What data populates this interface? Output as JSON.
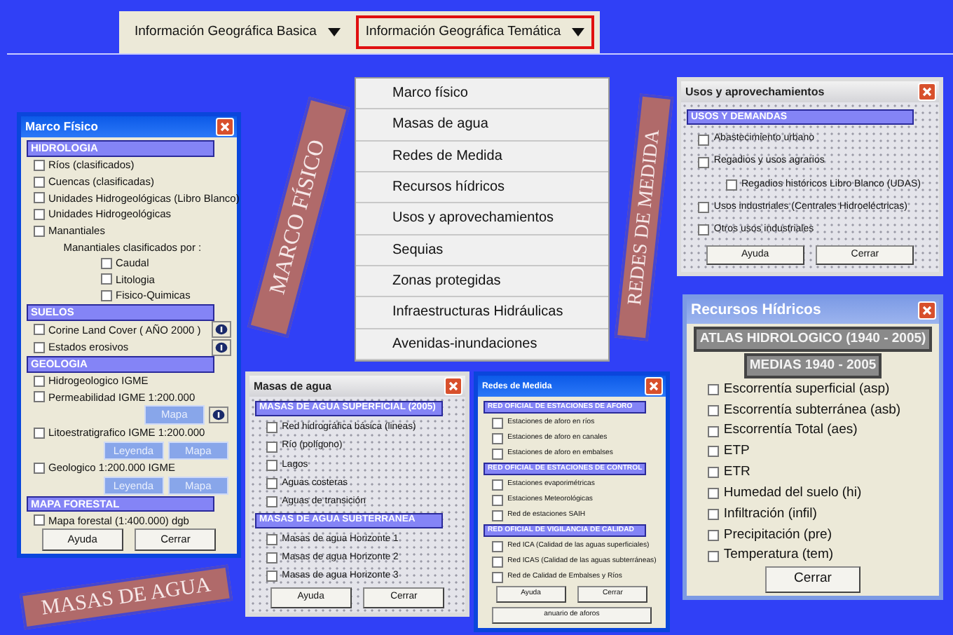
{
  "menubar": [
    {
      "label": "Información Geográfica Basica",
      "selected": false
    },
    {
      "label": "Información Geográfica Temática",
      "selected": true
    }
  ],
  "dropdown": {
    "items": [
      "Marco físico",
      "Masas de agua",
      "Redes de Medida",
      "Recursos hídricos",
      "Usos y aprovechamientos",
      "Sequias",
      "Zonas protegidas",
      "Infraestructuras Hidráulicas",
      "Avenidas-inundaciones"
    ]
  },
  "windows": [
    {
      "title": "Marco Físico",
      "kind": "xp-active",
      "grid": false,
      "rows": [
        {
          "kind": "section",
          "label": "HIDROLOGIA"
        },
        {
          "kind": "check",
          "label": "Ríos (clasificados)",
          "checked": false
        },
        {
          "kind": "check",
          "label": "Cuencas (clasificadas)",
          "checked": false
        },
        {
          "kind": "check",
          "label": "Unidades Hidrogeológicas (Libro Blanco)",
          "checked": false
        },
        {
          "kind": "check",
          "label": "Unidades Hidrogeológicas",
          "checked": false
        },
        {
          "kind": "check",
          "label": "Manantiales",
          "checked": false
        },
        {
          "kind": "note",
          "label": "Manantiales clasificados por :"
        },
        {
          "kind": "subcheck",
          "label": "Caudal",
          "checked": false
        },
        {
          "kind": "subcheck",
          "label": "Litologia",
          "checked": false
        },
        {
          "kind": "subcheck",
          "label": "Fisico-Quimicas",
          "checked": false
        },
        {
          "kind": "section",
          "label": "SUELOS"
        },
        {
          "kind": "check",
          "label": "Corine Land Cover ( AÑO 2000 )",
          "checked": false,
          "info": true
        },
        {
          "kind": "check",
          "label": "Estados erosivos",
          "checked": false,
          "info": true
        },
        {
          "kind": "section",
          "label": "GEOLOGIA"
        },
        {
          "kind": "check",
          "label": "Hidrogeologico IGME",
          "checked": false
        },
        {
          "kind": "check",
          "label": "Permeabilidad IGME 1:200.000",
          "checked": false,
          "info": true,
          "buttons": [
            "Mapa"
          ]
        },
        {
          "kind": "check",
          "label": "Litoestratigrafico IGME 1:200.000",
          "checked": false,
          "buttons": [
            "Leyenda",
            "Mapa"
          ]
        },
        {
          "kind": "check",
          "label": "Geologico 1:200.000 IGME",
          "checked": false,
          "buttons": [
            "Leyenda",
            "Mapa"
          ]
        },
        {
          "kind": "section",
          "label": "MAPA FORESTAL"
        },
        {
          "kind": "check",
          "label": "Mapa forestal (1:400.000) dgb",
          "checked": false
        },
        {
          "kind": "buttons",
          "buttons": [
            "Ayuda",
            "Cerrar"
          ]
        }
      ]
    },
    {
      "title": "Usos y aprovechamientos",
      "kind": "classic",
      "grid": true,
      "rows": [
        {
          "kind": "section",
          "label": "USOS Y DEMANDAS"
        },
        {
          "kind": "check",
          "label": "Abastecimiento urbano",
          "checked": false
        },
        {
          "kind": "check",
          "label": "Regadios y usos agrarios",
          "checked": false
        },
        {
          "kind": "subcheck",
          "label": "Regadios históricos Libro Blanco (UDAS)",
          "checked": false
        },
        {
          "kind": "check",
          "label": "Usos industriales (Centrales Hidroeléctricas)",
          "checked": false
        },
        {
          "kind": "check",
          "label": "Otros usos industriales",
          "checked": false
        },
        {
          "kind": "buttons",
          "buttons": [
            "Ayuda",
            "Cerrar"
          ]
        }
      ]
    },
    {
      "title": "Recursos Hídricos",
      "kind": "xp-inactive",
      "grid": false,
      "rows": [
        {
          "kind": "caption",
          "label": "ATLAS HIDROLOGICO (1940 - 2005)"
        },
        {
          "kind": "caption",
          "label": "MEDIAS 1940 - 2005"
        },
        {
          "kind": "check",
          "label": "Escorrentía superficial (asp)",
          "checked": false
        },
        {
          "kind": "check",
          "label": "Escorrentía subterránea (asb)",
          "checked": false
        },
        {
          "kind": "check",
          "label": "Escorrentía Total (aes)",
          "checked": false
        },
        {
          "kind": "check",
          "label": "ETP",
          "checked": false
        },
        {
          "kind": "check",
          "label": "ETR",
          "checked": false
        },
        {
          "kind": "check",
          "label": "Humedad del suelo (hi)",
          "checked": false
        },
        {
          "kind": "check",
          "label": "Infiltración (infil)",
          "checked": false
        },
        {
          "kind": "check",
          "label": "Precipitación (pre)",
          "checked": false
        },
        {
          "kind": "check",
          "label": "Temperatura (tem)",
          "checked": false
        },
        {
          "kind": "buttons",
          "buttons": [
            "Cerrar"
          ]
        }
      ]
    },
    {
      "title": "Masas de agua",
      "kind": "classic",
      "grid": true,
      "rows": [
        {
          "kind": "section",
          "label": "MASAS DE AGUA SUPERFICIAL (2005)"
        },
        {
          "kind": "check",
          "label": "Red hidrográfica básica (lineas)",
          "checked": false
        },
        {
          "kind": "check",
          "label": "Río (polígono)",
          "checked": false
        },
        {
          "kind": "check",
          "label": "Lagos",
          "checked": false
        },
        {
          "kind": "check",
          "label": "Aguas costeras",
          "checked": false
        },
        {
          "kind": "check",
          "label": "Aguas de transición",
          "checked": false
        },
        {
          "kind": "section",
          "label": "MASAS DE AGUA SUBTERRANEA"
        },
        {
          "kind": "check",
          "label": "Masas de agua Horizonte 1",
          "checked": false
        },
        {
          "kind": "check",
          "label": "Masas de agua Horizonte 2",
          "checked": false
        },
        {
          "kind": "check",
          "label": "Masas de agua Horizonte 3",
          "checked": false
        },
        {
          "kind": "buttons",
          "buttons": [
            "Ayuda",
            "Cerrar"
          ]
        }
      ]
    },
    {
      "title": "Redes de Medida",
      "kind": "xp-active",
      "grid": false,
      "rows": [
        {
          "kind": "section",
          "label": "RED OFICIAL DE ESTACIONES DE AFORO"
        },
        {
          "kind": "check",
          "label": "Estaciones de aforo en ríos",
          "checked": false
        },
        {
          "kind": "check",
          "label": "Estaciones de aforo en canales",
          "checked": false
        },
        {
          "kind": "check",
          "label": "Estaciones de aforo en embalses",
          "checked": false
        },
        {
          "kind": "section",
          "label": "RED OFICIAL DE ESTACIONES DE CONTROL"
        },
        {
          "kind": "check",
          "label": "Estaciones evaporimétricas",
          "checked": false
        },
        {
          "kind": "check",
          "label": "Estaciones Meteorológicas",
          "checked": false
        },
        {
          "kind": "check",
          "label": "Red de estaciones SAIH",
          "checked": false
        },
        {
          "kind": "section",
          "label": "RED OFICIAL DE VIGILANCIA DE CALIDAD"
        },
        {
          "kind": "check",
          "label": "Red ICA (Calidad de las aguas superficiales)",
          "checked": false
        },
        {
          "kind": "check",
          "label": "Red ICAS (Calidad de las aguas subterráneas)",
          "checked": false
        },
        {
          "kind": "check",
          "label": "Red de Calidad de Embalses y Ríos",
          "checked": false
        },
        {
          "kind": "buttons",
          "buttons": [
            "Ayuda",
            "Cerrar"
          ]
        },
        {
          "kind": "buttons",
          "buttons": [
            "anuario de aforos"
          ]
        }
      ]
    }
  ],
  "banners": [
    "MARCO FÍSICO",
    "MASAS DE AGUA",
    "REDES DE MEDIDA"
  ]
}
